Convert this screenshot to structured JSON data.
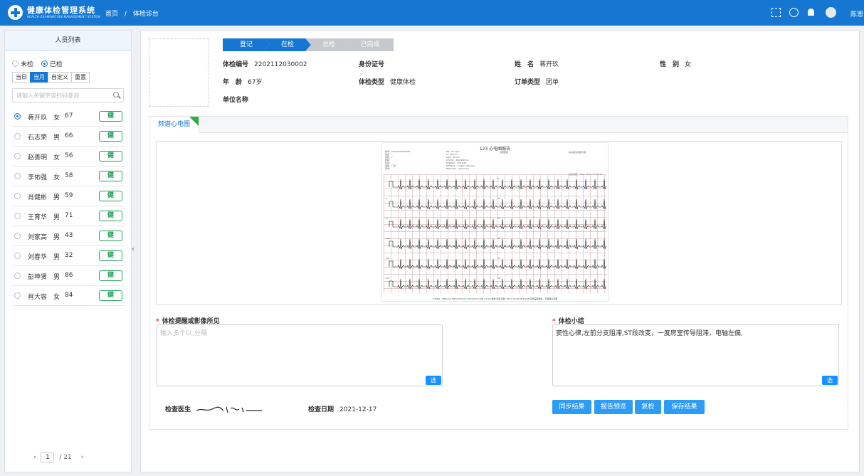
{
  "header": {
    "app_name": "健康体检管理系统",
    "app_subtitle": "HEALTH EXAMINATION MANAGEMENT SYSTEM",
    "breadcrumb": [
      "首页",
      "/",
      "体检诊台"
    ],
    "user_label": "陈恩"
  },
  "sidebar": {
    "title": "人员列表",
    "radio_options": [
      {
        "label": "未检",
        "selected": false
      },
      {
        "label": "已检",
        "selected": true
      }
    ],
    "date_buttons": [
      {
        "label": "当日",
        "active": false
      },
      {
        "label": "当月",
        "active": true
      },
      {
        "label": "自定义",
        "active": false
      },
      {
        "label": "重置",
        "active": false
      }
    ],
    "search_placeholder": "请输入关键字或扫码查询",
    "people": [
      {
        "name": "蒋开玖",
        "sex": "女",
        "age": "67",
        "selected": true,
        "btn": "健"
      },
      {
        "name": "石志荣",
        "sex": "男",
        "age": "66",
        "selected": false,
        "btn": "健"
      },
      {
        "name": "赵善明",
        "sex": "女",
        "age": "56",
        "selected": false,
        "btn": "健"
      },
      {
        "name": "李佑强",
        "sex": "女",
        "age": "58",
        "selected": false,
        "btn": "健"
      },
      {
        "name": "肖健彬",
        "sex": "男",
        "age": "59",
        "selected": false,
        "btn": "健"
      },
      {
        "name": "王育华",
        "sex": "男",
        "age": "71",
        "selected": false,
        "btn": "健"
      },
      {
        "name": "刘家高",
        "sex": "男",
        "age": "43",
        "selected": false,
        "btn": "健"
      },
      {
        "name": "刘春华",
        "sex": "男",
        "age": "32",
        "selected": false,
        "btn": "健"
      },
      {
        "name": "彭坤贤",
        "sex": "男",
        "age": "86",
        "selected": false,
        "btn": "健"
      },
      {
        "name": "肖大容",
        "sex": "女",
        "age": "84",
        "selected": false,
        "btn": "健"
      }
    ],
    "pager": {
      "prev": "‹",
      "current": "1",
      "sep": "/",
      "total": "21",
      "next": "›"
    }
  },
  "steps": [
    "登记",
    "在检",
    "总检",
    "已完成"
  ],
  "patient": {
    "exam_no_label": "体检编号",
    "exam_no": "2202112030002",
    "id_label": "身份证号",
    "id_value": "",
    "name_label": "姓　名",
    "name": "蒋开玖",
    "sex_label": "性　别",
    "sex": "女",
    "age_label": "年　龄",
    "age": "67岁",
    "type_label": "体检类型",
    "type": "健康体检",
    "order_label": "订单类型",
    "order": "团单",
    "unit_label": "单位名称",
    "unit": ""
  },
  "tab": {
    "label": "频谱心电图"
  },
  "ecg": {
    "title": "123 心电图报告",
    "left_info": [
      "编号：2021120300/608",
      "姓名：",
      "性别：F",
      "年龄：",
      "科室：",
      "病区：门诊",
      "床号："
    ],
    "mid_info": [
      "HR : 67 bpm",
      "P : 156 ms",
      "QRS : 96 ms",
      "QT/QTc : 390/408 ms",
      "P/QRS/T : 43/12/47",
      "RV5/SV1 : 1.820/1.194 mV",
      "RV5+SV1 : 3.014 mV"
    ],
    "diag_label": "诊断结果",
    "right_note": "请以医生诊断为准",
    "date_note": "检查日期：2021-12-03 10:08:49",
    "leads": [
      "I",
      "II",
      "III",
      "aVR",
      "aVL",
      "aVF"
    ],
    "leads_right": [
      "V1",
      "V2",
      "V3",
      "V4",
      "V5",
      "V6"
    ],
    "footer": "0.50Hz - 35Hz  AC 50Hz  25mm/s  10mm/mV  4X6  1.0.23  报告  检查日期: 2021-12-03 08:49:58  仅供临床参考，不能用来证明"
  },
  "findings": {
    "label": "体检提醒或影像所见",
    "placeholder": "输入多个以,分隔",
    "value": "",
    "btn": "选"
  },
  "summary": {
    "label": "体检小结",
    "value": "窦性心律,左前分支阻滞,ST段改变，一度房室传导阻滞，电轴左偏,",
    "btn": "选"
  },
  "footer_info": {
    "doctor_label": "检查医生",
    "date_label": "检查日期",
    "date": "2021-12-17"
  },
  "actions": [
    "同步结果",
    "报告预览",
    "复检",
    "保存结果"
  ],
  "colors": {
    "primary": "#1677d2",
    "accent_green": "#23a15b",
    "button_blue": "#2d9cf5"
  }
}
